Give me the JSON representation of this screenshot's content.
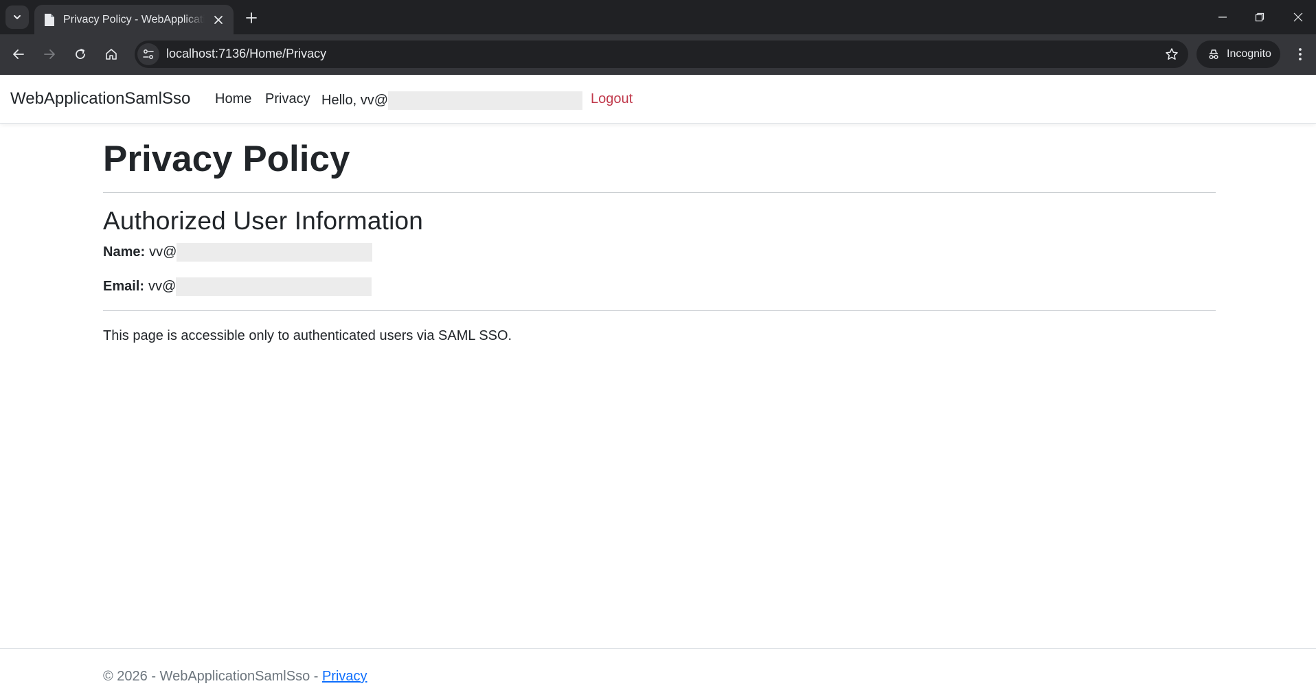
{
  "browser": {
    "tab_title": "Privacy Policy - WebApplicationSamlSso",
    "url": "localhost:7136/Home/Privacy",
    "incognito_label": "Incognito"
  },
  "navbar": {
    "brand": "WebApplicationSamlSso",
    "links": [
      "Home",
      "Privacy"
    ],
    "hello_text": "Hello, vv@",
    "logout_label": "Logout"
  },
  "main": {
    "title": "Privacy Policy",
    "section_title": "Authorized User Information",
    "name_label": "Name:",
    "name_value": "vv@",
    "email_label": "Email:",
    "email_value": "vv@",
    "note": "This page is accessible only to authenticated users via SAML SSO."
  },
  "footer": {
    "text": "© 2026 - WebApplicationSamlSso - ",
    "privacy_link": "Privacy"
  },
  "colors": {
    "logout": "#c0394b",
    "link": "#0d6efd",
    "chrome_dark": "#202124",
    "chrome_toolbar": "#35363a"
  }
}
